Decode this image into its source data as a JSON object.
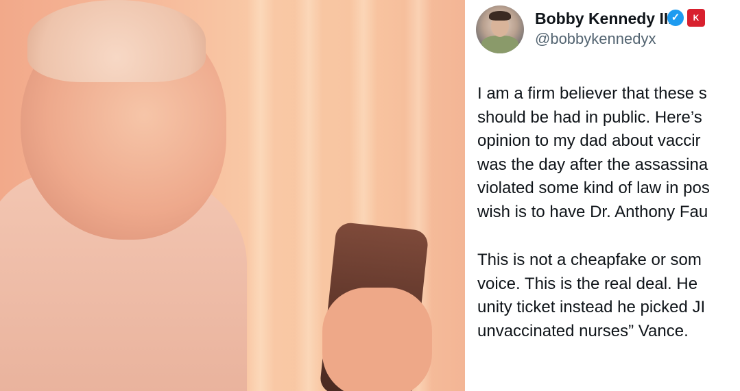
{
  "tweet": {
    "author_name": "Bobby Kennedy III",
    "handle": "@bobbykennedyx",
    "verified_icon": "verified-check-icon",
    "badge_label": "K",
    "lines": [
      "I am a firm believer that these s",
      "should be had in public.  Here’s",
      "opinion to my dad about  vaccir",
      "was the day after the assassina",
      "violated some kind of law in pos",
      "wish is to have Dr. Anthony Fau"
    ],
    "lines2": [
      " This is not a cheapfake or som",
      "voice. This is the real deal.   He",
      "unity ticket instead he picked JI",
      "unvaccinated nurses” Vance."
    ]
  }
}
